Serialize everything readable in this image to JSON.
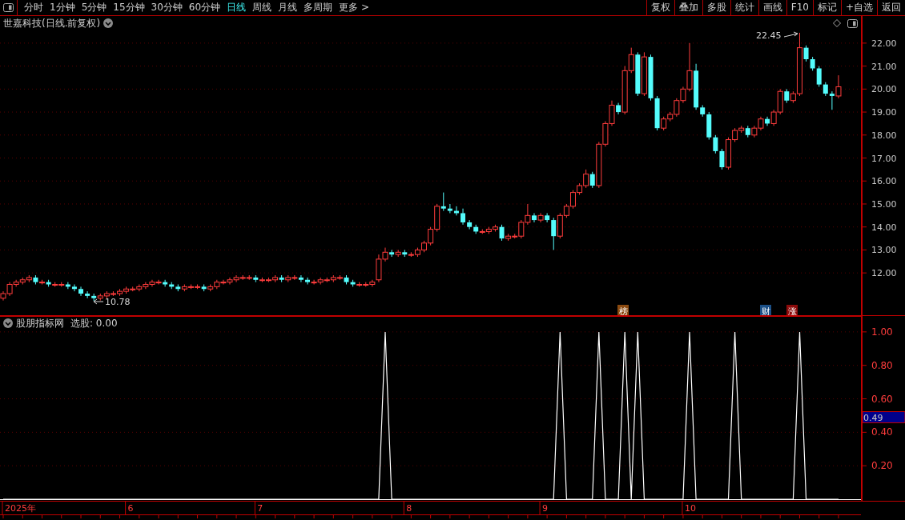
{
  "toolbar": {
    "periods": [
      {
        "label": "分时",
        "selected": false
      },
      {
        "label": "1分钟",
        "selected": false
      },
      {
        "label": "5分钟",
        "selected": false
      },
      {
        "label": "15分钟",
        "selected": false
      },
      {
        "label": "30分钟",
        "selected": false
      },
      {
        "label": "60分钟",
        "selected": false
      },
      {
        "label": "日线",
        "selected": true
      },
      {
        "label": "周线",
        "selected": false
      },
      {
        "label": "月线",
        "selected": false
      },
      {
        "label": "多周期",
        "selected": false
      },
      {
        "label": "更多 >",
        "selected": false
      }
    ],
    "buttons": [
      "复权",
      "叠加",
      "多股",
      "统计",
      "画线",
      "F10",
      "标记",
      "+自选",
      "返回"
    ]
  },
  "chart": {
    "title": "世嘉科技(日线.前复权)",
    "high_label": "22.45",
    "low_label": "10.78",
    "event_tags": [
      {
        "label": "榜",
        "color": "#8b4a10"
      },
      {
        "label": "财",
        "color": "#1b4f86"
      },
      {
        "label": "涨",
        "color": "#8b0a0a"
      }
    ],
    "chart_data": {
      "type": "candlestick",
      "ylim": [
        10.16,
        23.18
      ],
      "grid": true,
      "yticks": [
        {
          "value": 22,
          "label": "22.00"
        },
        {
          "value": 21,
          "label": "21.00"
        },
        {
          "value": 20,
          "label": "20.00"
        },
        {
          "value": 19,
          "label": "19.00"
        },
        {
          "value": 18,
          "label": "18.00"
        },
        {
          "value": 17,
          "label": "17.00"
        },
        {
          "value": 16,
          "label": "16.00"
        },
        {
          "value": 15,
          "label": "15.00"
        },
        {
          "value": 14,
          "label": "14.00"
        },
        {
          "value": 13,
          "label": "13.00"
        },
        {
          "value": 12,
          "label": "12.00"
        }
      ],
      "ohlc": [
        [
          10.9,
          11.2,
          10.8,
          11.1
        ],
        [
          11.1,
          11.6,
          11.0,
          11.5
        ],
        [
          11.5,
          11.7,
          11.4,
          11.6
        ],
        [
          11.6,
          11.8,
          11.5,
          11.7
        ],
        [
          11.7,
          11.9,
          11.6,
          11.8
        ],
        [
          11.8,
          11.9,
          11.5,
          11.6
        ],
        [
          11.6,
          11.7,
          11.5,
          11.6
        ],
        [
          11.6,
          11.7,
          11.4,
          11.5
        ],
        [
          11.5,
          11.6,
          11.4,
          11.5
        ],
        [
          11.5,
          11.6,
          11.4,
          11.5
        ],
        [
          11.5,
          11.6,
          11.3,
          11.4
        ],
        [
          11.4,
          11.5,
          11.2,
          11.3
        ],
        [
          11.3,
          11.4,
          11.0,
          11.1
        ],
        [
          11.1,
          11.2,
          10.9,
          11.0
        ],
        [
          11.0,
          11.1,
          10.78,
          10.9
        ],
        [
          10.9,
          11.1,
          10.8,
          11.0
        ],
        [
          11.0,
          11.2,
          10.9,
          11.1
        ],
        [
          11.1,
          11.2,
          11.0,
          11.1
        ],
        [
          11.1,
          11.3,
          11.0,
          11.2
        ],
        [
          11.2,
          11.4,
          11.1,
          11.3
        ],
        [
          11.3,
          11.4,
          11.2,
          11.3
        ],
        [
          11.3,
          11.5,
          11.2,
          11.4
        ],
        [
          11.4,
          11.6,
          11.3,
          11.5
        ],
        [
          11.5,
          11.7,
          11.4,
          11.6
        ],
        [
          11.6,
          11.7,
          11.5,
          11.6
        ],
        [
          11.6,
          11.7,
          11.4,
          11.5
        ],
        [
          11.5,
          11.6,
          11.3,
          11.4
        ],
        [
          11.4,
          11.5,
          11.2,
          11.3
        ],
        [
          11.3,
          11.5,
          11.2,
          11.4
        ],
        [
          11.4,
          11.5,
          11.3,
          11.4
        ],
        [
          11.4,
          11.5,
          11.3,
          11.4
        ],
        [
          11.4,
          11.5,
          11.2,
          11.3
        ],
        [
          11.3,
          11.5,
          11.2,
          11.4
        ],
        [
          11.4,
          11.7,
          11.3,
          11.6
        ],
        [
          11.6,
          11.7,
          11.5,
          11.6
        ],
        [
          11.6,
          11.8,
          11.5,
          11.7
        ],
        [
          11.7,
          11.9,
          11.6,
          11.8
        ],
        [
          11.8,
          11.9,
          11.7,
          11.8
        ],
        [
          11.8,
          11.9,
          11.7,
          11.8
        ],
        [
          11.8,
          11.9,
          11.6,
          11.7
        ],
        [
          11.7,
          11.8,
          11.6,
          11.7
        ],
        [
          11.7,
          11.8,
          11.6,
          11.7
        ],
        [
          11.7,
          11.9,
          11.6,
          11.8
        ],
        [
          11.8,
          11.9,
          11.6,
          11.7
        ],
        [
          11.7,
          11.9,
          11.6,
          11.8
        ],
        [
          11.8,
          11.9,
          11.7,
          11.8
        ],
        [
          11.8,
          11.9,
          11.6,
          11.7
        ],
        [
          11.7,
          11.8,
          11.5,
          11.6
        ],
        [
          11.6,
          11.7,
          11.5,
          11.6
        ],
        [
          11.6,
          11.8,
          11.5,
          11.7
        ],
        [
          11.7,
          11.8,
          11.6,
          11.7
        ],
        [
          11.7,
          11.9,
          11.6,
          11.8
        ],
        [
          11.8,
          11.9,
          11.7,
          11.8
        ],
        [
          11.8,
          11.9,
          11.5,
          11.6
        ],
        [
          11.6,
          11.7,
          11.4,
          11.5
        ],
        [
          11.5,
          11.6,
          11.4,
          11.5
        ],
        [
          11.5,
          11.6,
          11.4,
          11.5
        ],
        [
          11.5,
          11.7,
          11.4,
          11.6
        ],
        [
          11.7,
          12.8,
          11.6,
          12.6
        ],
        [
          12.6,
          13.1,
          12.5,
          12.9
        ],
        [
          12.9,
          13.0,
          12.7,
          12.8
        ],
        [
          12.8,
          13.0,
          12.7,
          12.9
        ],
        [
          12.9,
          13.0,
          12.7,
          12.8
        ],
        [
          12.8,
          12.9,
          12.7,
          12.8
        ],
        [
          12.8,
          13.1,
          12.7,
          13.0
        ],
        [
          13.0,
          13.4,
          12.9,
          13.3
        ],
        [
          13.3,
          14.0,
          13.2,
          13.9
        ],
        [
          13.9,
          15.0,
          13.8,
          14.9
        ],
        [
          14.9,
          15.5,
          14.7,
          14.8
        ],
        [
          14.8,
          15.0,
          14.6,
          14.7
        ],
        [
          14.7,
          14.9,
          14.5,
          14.6
        ],
        [
          14.6,
          14.8,
          14.1,
          14.2
        ],
        [
          14.2,
          14.3,
          13.9,
          14.0
        ],
        [
          14.0,
          14.1,
          13.7,
          13.8
        ],
        [
          13.8,
          13.9,
          13.7,
          13.8
        ],
        [
          13.8,
          14.0,
          13.7,
          13.9
        ],
        [
          13.9,
          14.1,
          13.8,
          14.0
        ],
        [
          14.0,
          14.1,
          13.4,
          13.5
        ],
        [
          13.5,
          13.7,
          13.4,
          13.6
        ],
        [
          13.6,
          13.7,
          13.5,
          13.6
        ],
        [
          13.6,
          14.3,
          13.5,
          14.2
        ],
        [
          14.2,
          15.0,
          14.1,
          14.5
        ],
        [
          14.5,
          14.6,
          14.2,
          14.3
        ],
        [
          14.3,
          14.6,
          14.2,
          14.5
        ],
        [
          14.5,
          14.6,
          14.2,
          14.3
        ],
        [
          14.3,
          14.4,
          13.0,
          13.6
        ],
        [
          13.6,
          14.6,
          13.5,
          14.5
        ],
        [
          14.5,
          15.0,
          14.4,
          14.9
        ],
        [
          14.9,
          15.6,
          14.8,
          15.5
        ],
        [
          15.5,
          15.9,
          15.4,
          15.8
        ],
        [
          15.8,
          16.5,
          15.7,
          16.3
        ],
        [
          16.3,
          16.4,
          15.7,
          15.8
        ],
        [
          15.8,
          17.7,
          15.7,
          17.6
        ],
        [
          17.6,
          18.6,
          17.5,
          18.5
        ],
        [
          18.5,
          19.5,
          18.4,
          19.3
        ],
        [
          19.3,
          19.4,
          18.9,
          19.0
        ],
        [
          19.0,
          21.0,
          18.9,
          20.8
        ],
        [
          20.8,
          21.8,
          20.7,
          21.5
        ],
        [
          21.5,
          21.6,
          19.7,
          19.8
        ],
        [
          19.8,
          21.6,
          19.7,
          21.4
        ],
        [
          21.4,
          21.5,
          19.5,
          19.6
        ],
        [
          19.6,
          19.7,
          18.2,
          18.3
        ],
        [
          18.3,
          18.8,
          18.2,
          18.7
        ],
        [
          18.7,
          19.0,
          18.6,
          18.9
        ],
        [
          18.9,
          19.6,
          18.8,
          19.5
        ],
        [
          19.5,
          20.1,
          19.4,
          20.0
        ],
        [
          20.0,
          22.0,
          19.9,
          20.8
        ],
        [
          20.8,
          21.1,
          19.1,
          19.2
        ],
        [
          19.2,
          19.3,
          18.8,
          18.9
        ],
        [
          18.9,
          19.0,
          17.8,
          17.9
        ],
        [
          17.9,
          18.0,
          17.2,
          17.3
        ],
        [
          17.3,
          17.4,
          16.5,
          16.6
        ],
        [
          16.6,
          17.9,
          16.5,
          17.8
        ],
        [
          17.8,
          18.3,
          17.7,
          18.2
        ],
        [
          18.2,
          18.4,
          18.1,
          18.3
        ],
        [
          18.3,
          18.4,
          17.9,
          18.0
        ],
        [
          18.0,
          18.4,
          17.9,
          18.3
        ],
        [
          18.3,
          18.8,
          18.2,
          18.7
        ],
        [
          18.7,
          18.8,
          18.4,
          18.5
        ],
        [
          18.5,
          19.1,
          18.4,
          19.0
        ],
        [
          19.0,
          20.0,
          18.9,
          19.9
        ],
        [
          19.9,
          20.0,
          19.4,
          19.5
        ],
        [
          19.5,
          19.9,
          19.4,
          19.8
        ],
        [
          19.8,
          22.45,
          19.7,
          21.8
        ],
        [
          21.8,
          21.9,
          21.2,
          21.3
        ],
        [
          21.3,
          21.4,
          20.8,
          20.9
        ],
        [
          20.9,
          21.0,
          20.1,
          20.2
        ],
        [
          20.2,
          20.3,
          19.7,
          19.8
        ],
        [
          19.8,
          19.9,
          19.1,
          19.7
        ],
        [
          19.7,
          20.6,
          19.6,
          20.1
        ]
      ]
    }
  },
  "indicator": {
    "name": "股朋指标网",
    "reading": "选股: 0.00",
    "cursor_value": "0.49",
    "chart_data": {
      "type": "line",
      "ylim": [
        0,
        1.095
      ],
      "grid": true,
      "yticks": [
        {
          "value": 1.0,
          "label": "1.00"
        },
        {
          "value": 0.8,
          "label": "0.80"
        },
        {
          "value": 0.6,
          "label": "0.60"
        },
        {
          "value": 0.4,
          "label": "0.40"
        },
        {
          "value": 0.2,
          "label": "0.20"
        }
      ],
      "series": [
        {
          "color": "#ffffff",
          "values": [
            0,
            0,
            0,
            0,
            0,
            0,
            0,
            0,
            0,
            0,
            0,
            0,
            0,
            0,
            0,
            0,
            0,
            0,
            0,
            0,
            0,
            0,
            0,
            0,
            0,
            0,
            0,
            0,
            0,
            0,
            0,
            0,
            0,
            0,
            0,
            0,
            0,
            0,
            0,
            0,
            0,
            0,
            0,
            0,
            0,
            0,
            0,
            0,
            0,
            0,
            0,
            0,
            0,
            0,
            0,
            0,
            0,
            0,
            0,
            1,
            0,
            0,
            0,
            0,
            0,
            0,
            0,
            0,
            0,
            0,
            0,
            0,
            0,
            0,
            0,
            0,
            0,
            0,
            0,
            0,
            0,
            0,
            0,
            0,
            0,
            0,
            1,
            0,
            0,
            0,
            0,
            0,
            1,
            0,
            0,
            0,
            1,
            0,
            1,
            0,
            0,
            0,
            0,
            0,
            0,
            0,
            1,
            0,
            0,
            0,
            0,
            0,
            0,
            1,
            0,
            0,
            0,
            0,
            0,
            0,
            0,
            0,
            0,
            1,
            0,
            0,
            0,
            0,
            0,
            0
          ]
        }
      ]
    }
  },
  "date_axis": [
    "2025年",
    "6",
    "7",
    "8",
    "9",
    "10"
  ]
}
